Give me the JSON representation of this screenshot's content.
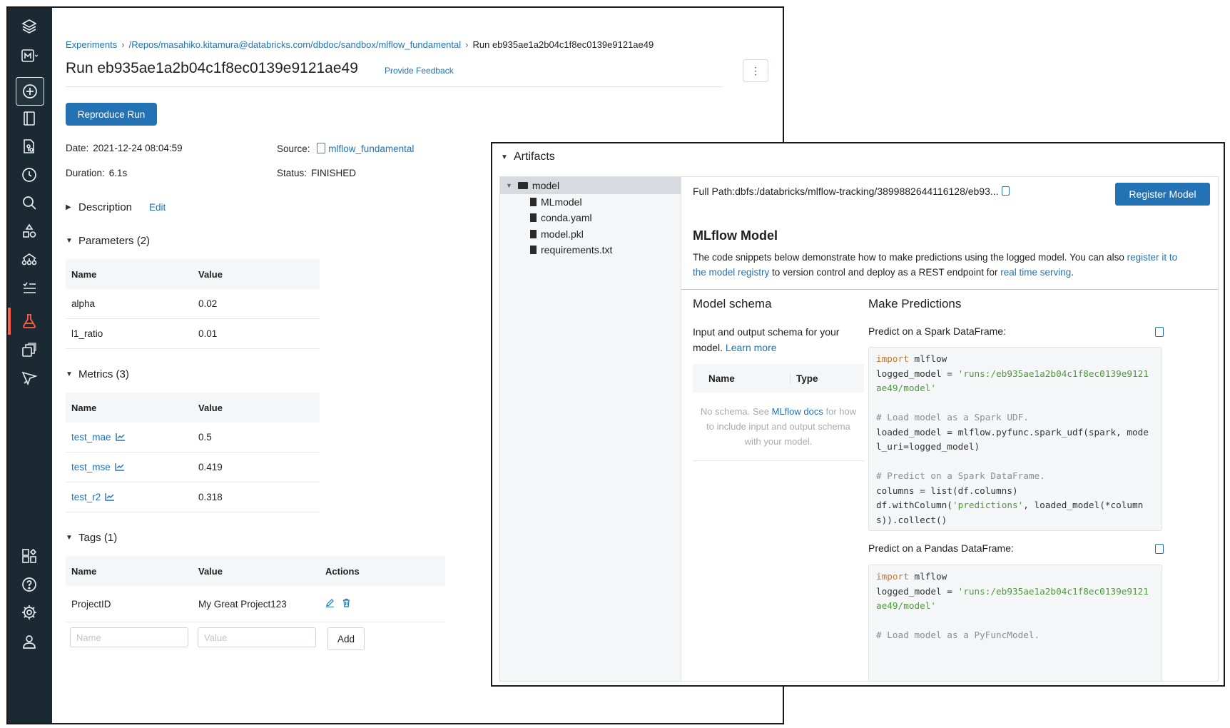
{
  "breadcrumb": {
    "items": [
      "Experiments",
      "/Repos/masahiko.kitamura@databricks.com/dbdoc/sandbox/mlflow_fundamental",
      "Run eb935ae1a2b04c1f8ec0139e9121ae49"
    ]
  },
  "header": {
    "title": "Run eb935ae1a2b04c1f8ec0139e9121ae49",
    "feedback_label": "Provide Feedback",
    "more_label": "⋮"
  },
  "actions": {
    "reproduce_label": "Reproduce Run"
  },
  "meta": {
    "date_key": "Date:",
    "date_value": "2021-12-24 08:04:59",
    "duration_key": "Duration:",
    "duration_value": "6.1s",
    "source_key": "Source:",
    "source_value": "mlflow_fundamental",
    "status_key": "Status:",
    "status_value": "FINISHED"
  },
  "description": {
    "label": "Description",
    "edit_label": "Edit"
  },
  "parameters": {
    "label": "Parameters (2)",
    "headers": [
      "Name",
      "Value"
    ],
    "rows": [
      {
        "name": "alpha",
        "value": "0.02"
      },
      {
        "name": "l1_ratio",
        "value": "0.01"
      }
    ]
  },
  "metrics": {
    "label": "Metrics (3)",
    "headers": [
      "Name",
      "Value"
    ],
    "rows": [
      {
        "name": "test_mae",
        "value": "0.5"
      },
      {
        "name": "test_mse",
        "value": "0.419"
      },
      {
        "name": "test_r2",
        "value": "0.318"
      }
    ]
  },
  "tags": {
    "label": "Tags (1)",
    "headers": [
      "Name",
      "Value",
      "Actions"
    ],
    "rows": [
      {
        "name": "ProjectID",
        "value": "My Great Project123"
      }
    ],
    "name_placeholder": "Name",
    "value_placeholder": "Value",
    "add_label": "Add"
  },
  "artifacts": {
    "label": "Artifacts",
    "root": "model",
    "files": [
      "MLmodel",
      "conda.yaml",
      "model.pkl",
      "requirements.txt"
    ],
    "full_path": "Full Path:dbfs:/databricks/mlflow-tracking/3899882644116128/eb93...",
    "register_label": "Register Model",
    "model_title": "MLflow Model",
    "desc_1": "The code snippets below demonstrate how to make predictions using the logged model. You can also ",
    "desc_link_1": "register it to the model registry",
    "desc_2": " to version control and deploy as a REST endpoint for ",
    "desc_link_2": "real time serving",
    "desc_3": ".",
    "schema_title": "Model schema",
    "schema_desc": "Input and output schema for your model. ",
    "schema_learn_more": "Learn more",
    "schema_headers": [
      "Name",
      "Type"
    ],
    "schema_empty_1": "No schema. See ",
    "schema_empty_link": "MLflow docs",
    "schema_empty_2": " for how to include input and output schema with your model.",
    "predict_title": "Make Predictions",
    "spark_label": "Predict on a Spark DataFrame:",
    "pandas_label": "Predict on a Pandas DataFrame:",
    "spark_code": {
      "l1_kw": "import",
      "l1_rest": " mlflow",
      "l2_a": "logged_model = ",
      "l2_str": "'runs:/eb935ae1a2b04c1f8ec0139e9121",
      "l3_str": "ae49/model'",
      "l5_cm": "# Load model as a Spark UDF.",
      "l6": "loaded_model = mlflow.pyfunc.spark_udf(spark, mode",
      "l7": "l_uri=logged_model)",
      "l9_cm": "# Predict on a Spark DataFrame.",
      "l10": "columns = list(df.columns)",
      "l11_a": "df.withColumn(",
      "l11_str": "'predictions'",
      "l11_b": ", loaded_model(*column",
      "l12": "s)).collect()"
    },
    "pandas_code": {
      "l1_kw": "import",
      "l1_rest": " mlflow",
      "l2_a": "logged_model = ",
      "l2_str": "'runs:/eb935ae1a2b04c1f8ec0139e9121",
      "l3_str": "ae49/model'",
      "l5_cm": "# Load model as a PyFuncModel."
    }
  },
  "colors": {
    "sidebar": "#1b2a32",
    "accent": "#2272b4",
    "active_nav": "#ff5f46"
  }
}
